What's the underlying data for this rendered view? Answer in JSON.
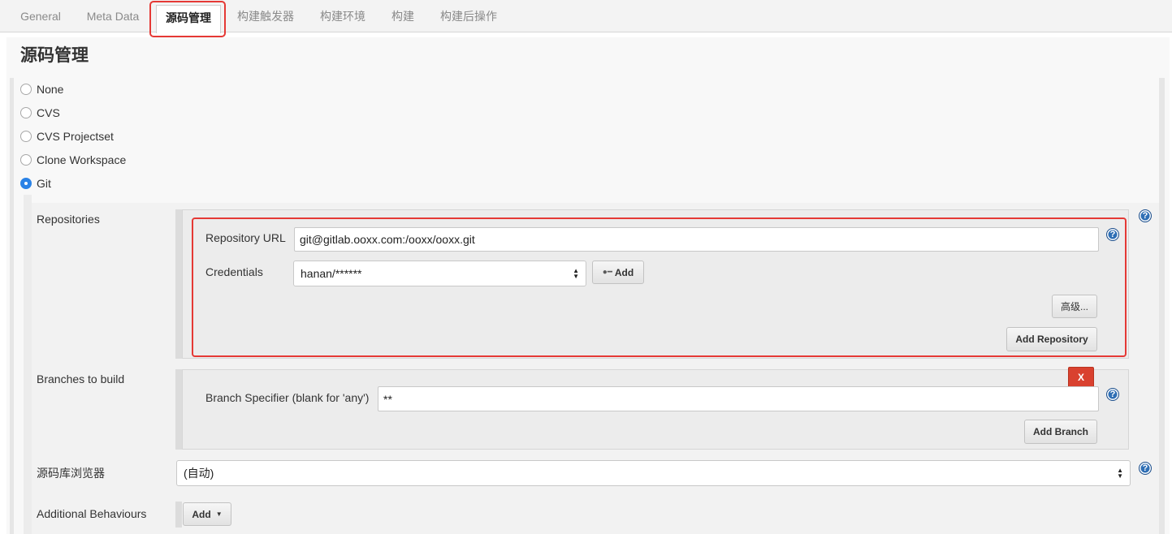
{
  "tabs": [
    {
      "label": "General"
    },
    {
      "label": "Meta Data"
    },
    {
      "label": "源码管理"
    },
    {
      "label": "构建触发器"
    },
    {
      "label": "构建环境"
    },
    {
      "label": "构建"
    },
    {
      "label": "构建后操作"
    }
  ],
  "active_tab": "源码管理",
  "section": {
    "title": "源码管理"
  },
  "scm_options": [
    {
      "label": "None",
      "checked": false
    },
    {
      "label": "CVS",
      "checked": false
    },
    {
      "label": "CVS Projectset",
      "checked": false
    },
    {
      "label": "Clone Workspace",
      "checked": false
    },
    {
      "label": "Git",
      "checked": true
    }
  ],
  "repositories": {
    "label": "Repositories",
    "url_label": "Repository URL",
    "url_value": "git@gitlab.ooxx.com:/ooxx/ooxx.git",
    "credentials_label": "Credentials",
    "credentials_value": "hanan/******",
    "add_credentials_label": "Add",
    "advanced_label": "高级...",
    "add_repository_label": "Add Repository"
  },
  "branches": {
    "label": "Branches to build",
    "delete_label": "X",
    "specifier_label": "Branch Specifier (blank for 'any')",
    "specifier_value": "**",
    "add_branch_label": "Add Branch"
  },
  "browser": {
    "label": "源码库浏览器",
    "value": "(自动)"
  },
  "behaviours": {
    "label": "Additional Behaviours",
    "add_label": "Add"
  },
  "help_glyph": "?",
  "colors": {
    "highlight": "#e53935",
    "radio_checked": "#2a82e6",
    "help_icon": "#2f6fb5",
    "delete_button": "#d9412f"
  }
}
